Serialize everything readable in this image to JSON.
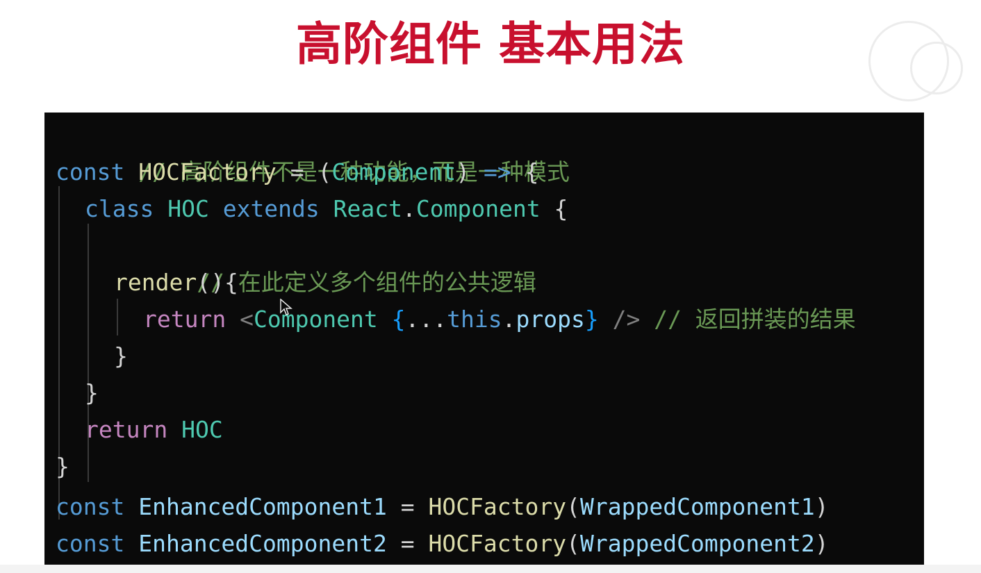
{
  "slide": {
    "title": "高阶组件 基本用法"
  },
  "code": {
    "line1": {
      "comment": "// 高阶组件不是一种功能，而是一种模式"
    },
    "line2": {
      "kw": "const",
      "name": "HOCFactory",
      "eq": " = (",
      "param": "Component",
      "close": ") ",
      "arrow": "=>",
      "brace": " {"
    },
    "line3": {
      "kw": "class",
      "name": "HOC",
      "extends": "extends",
      "obj": "React",
      "dot": ".",
      "cls": "Component",
      "brace": " {"
    },
    "line4": {
      "comment": "// 在此定义多个组件的公共逻辑"
    },
    "line5": {
      "fn": "render",
      "rest": "(){"
    },
    "line6": {
      "ret": "return",
      "lt": "<",
      "tag": "Component",
      "open": "{",
      "spread": "...",
      "this": "this",
      "dot": ".",
      "prop": "props",
      "close": "}",
      "end": " />",
      "comment": "// 返回拼装的结果"
    },
    "line7": {
      "text": "}"
    },
    "line8": {
      "text": "}"
    },
    "line9": {
      "ret": "return",
      "name": "HOC"
    },
    "line10": {
      "text": "}"
    },
    "line11": {
      "kw": "const",
      "name": "EnhancedComponent1",
      "eq": " = ",
      "fn": "HOCFactory",
      "open": "(",
      "arg": "WrappedComponent1",
      "close": ")"
    },
    "line12": {
      "kw": "const",
      "name": "EnhancedComponent2",
      "eq": " = ",
      "fn": "HOCFactory",
      "open": "(",
      "arg": "WrappedComponent2",
      "close": ")"
    }
  },
  "colors": {
    "title": "#c8102e",
    "editor_background": "#0a0a0a",
    "comment": "#6a9955",
    "keyword": "#569cd6",
    "control": "#c586c0",
    "function": "#dcdcaa",
    "type": "#4ec9b0",
    "variable": "#9cdcfe"
  },
  "icons": {
    "cursor": "mouse-pointer-icon"
  }
}
